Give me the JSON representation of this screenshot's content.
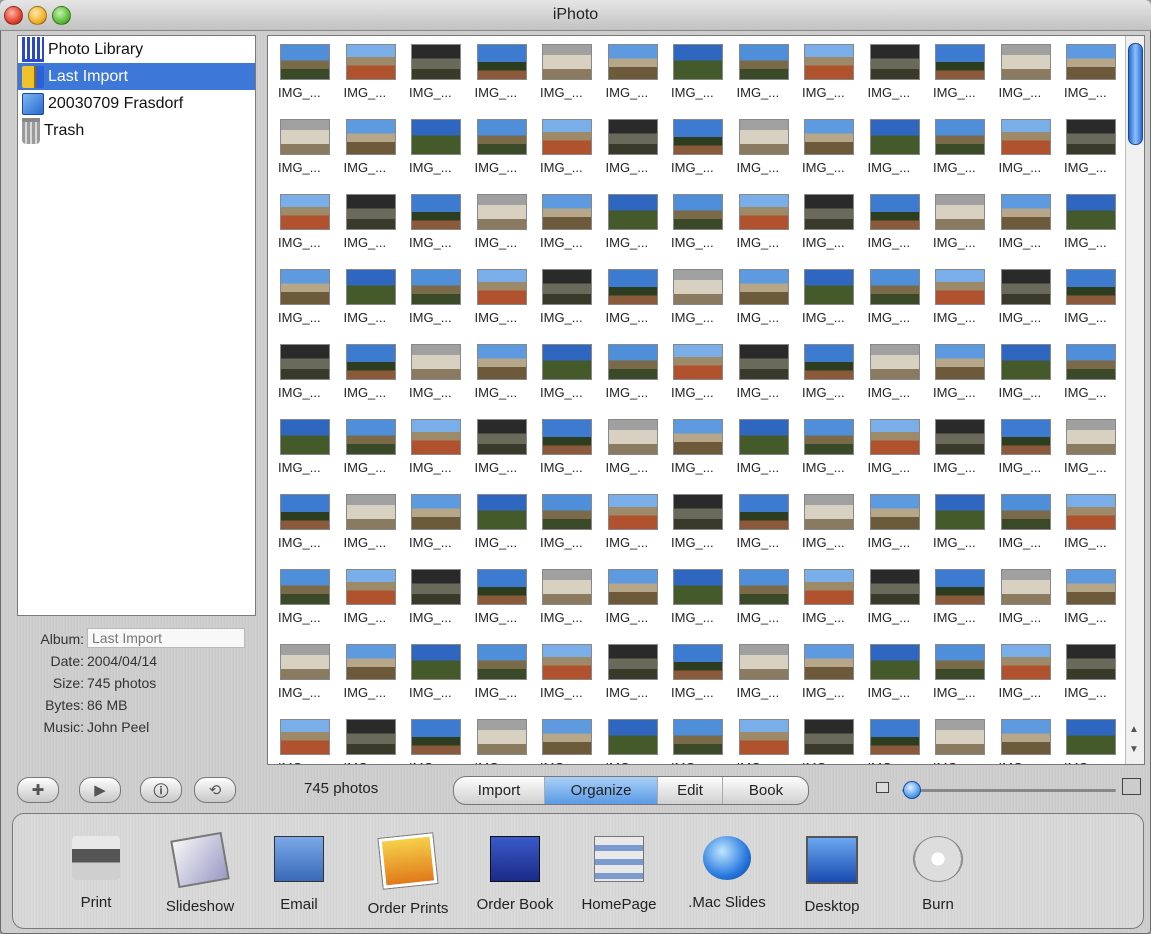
{
  "window": {
    "title": "iPhoto"
  },
  "source_list": {
    "items": [
      {
        "label": "Photo Library",
        "icon": "photo-library-icon",
        "selected": false
      },
      {
        "label": "Last Import",
        "icon": "last-import-icon",
        "selected": true
      },
      {
        "label": "20030709 Frasdorf",
        "icon": "album-icon",
        "selected": false
      },
      {
        "label": "Trash",
        "icon": "trash-icon",
        "selected": false
      }
    ]
  },
  "info": {
    "album_label": "Album:",
    "album_value": "Last Import",
    "date_label": "Date:",
    "date_value": "2004/04/14",
    "size_label": "Size:",
    "size_value": "745 photos",
    "bytes_label": "Bytes:",
    "bytes_value": "86 MB",
    "music_label": "Music:",
    "music_value": "John Peel"
  },
  "grid": {
    "thumb_label": "IMG_...",
    "columns": 13,
    "visible_rows": 10
  },
  "toolbar": {
    "add_icon": "plus-icon",
    "play_icon": "play-icon",
    "info_icon": "info-icon",
    "rotate_icon": "rotate-icon",
    "photo_count": "745 photos",
    "modes": [
      {
        "label": "Import",
        "active": false
      },
      {
        "label": "Organize",
        "active": true
      },
      {
        "label": "Edit",
        "active": false
      },
      {
        "label": "Book",
        "active": false
      }
    ],
    "thumbnail_size_fraction": 0.02
  },
  "actions": [
    {
      "label": "Print",
      "icon": "printer-icon"
    },
    {
      "label": "Slideshow",
      "icon": "slideshow-icon"
    },
    {
      "label": "Email",
      "icon": "email-icon"
    },
    {
      "label": "Order Prints",
      "icon": "order-prints-icon"
    },
    {
      "label": "Order Book",
      "icon": "order-book-icon"
    },
    {
      "label": "HomePage",
      "icon": "homepage-icon"
    },
    {
      "label": ".Mac Slides",
      "icon": "mac-slides-icon"
    },
    {
      "label": "Desktop",
      "icon": "desktop-icon"
    },
    {
      "label": "Burn",
      "icon": "burn-icon"
    }
  ],
  "colors": {
    "selection": "#3d78d8",
    "active_mode": "#5a9ae6"
  }
}
